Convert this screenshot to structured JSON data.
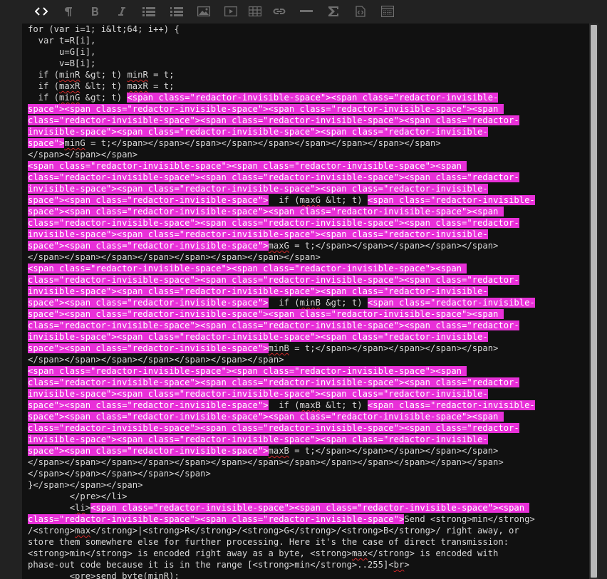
{
  "toolbar": {
    "buttons": [
      {
        "name": "html-toggle",
        "glyph": "<>",
        "active": true
      },
      {
        "name": "paragraph",
        "glyph": "¶"
      },
      {
        "name": "bold",
        "glyph": "B"
      },
      {
        "name": "italic",
        "glyph": "I"
      },
      {
        "name": "unordered-list",
        "glyph": ""
      },
      {
        "name": "ordered-list",
        "glyph": ""
      },
      {
        "name": "image",
        "glyph": ""
      },
      {
        "name": "video",
        "glyph": ""
      },
      {
        "name": "table",
        "glyph": ""
      },
      {
        "name": "link",
        "glyph": ""
      },
      {
        "name": "horizontal-rule",
        "glyph": ""
      },
      {
        "name": "formula",
        "glyph": "Σ"
      },
      {
        "name": "code",
        "glyph": ""
      },
      {
        "name": "snippet",
        "glyph": ""
      }
    ]
  },
  "editor": {
    "lines": [
      [
        {
          "t": "for (var i=1; i&lt;64; i++) {"
        }
      ],
      [
        {
          "t": "  var t=R[i],"
        }
      ],
      [
        {
          "t": "      u=G[i],"
        }
      ],
      [
        {
          "t": "      v=B[i];"
        }
      ],
      [
        {
          "t": "  if ("
        },
        {
          "t": "minR",
          "sq": true
        },
        {
          "t": " &gt; t) "
        },
        {
          "t": "minR",
          "sq": true
        },
        {
          "t": " = t;"
        }
      ],
      [
        {
          "t": "  if ("
        },
        {
          "t": "maxR",
          "sq": true
        },
        {
          "t": " &lt; t) "
        },
        {
          "t": "maxR",
          "sq": true
        },
        {
          "t": " = t;"
        }
      ],
      [
        {
          "t": "  if ("
        },
        {
          "t": "minG",
          "sq": true
        },
        {
          "t": " &gt; t) "
        },
        {
          "t": "<span class=\"redactor-invisible-space\"><span class=\"redactor-invisible-",
          "hl": true
        }
      ],
      [
        {
          "t": "space\"><span class=\"redactor-invisible-space\"><span class=\"redactor-invisible-space\"><span ",
          "hl": true
        }
      ],
      [
        {
          "t": "class=\"redactor-invisible-space\"><span class=\"redactor-invisible-space\"><span class=\"redactor-",
          "hl": true
        }
      ],
      [
        {
          "t": "invisible-space\"><span class=\"redactor-invisible-space\"><span class=\"redactor-invisible-",
          "hl": true
        }
      ],
      [
        {
          "t": "space\">",
          "hl": true
        },
        {
          "t": "minG",
          "sq": true
        },
        {
          "t": " = t;</span></span></span></span></span></span></span></span></span>"
        }
      ],
      [
        {
          "t": "</span></span></span>"
        }
      ],
      [
        {
          "t": "<span class=\"redactor-invisible-space\"><span class=\"redactor-invisible-space\"><span ",
          "hl": true
        }
      ],
      [
        {
          "t": "class=\"redactor-invisible-space\"><span class=\"redactor-invisible-space\"><span class=\"redactor-",
          "hl": true
        }
      ],
      [
        {
          "t": "invisible-space\"><span class=\"redactor-invisible-space\"><span class=\"redactor-invisible-",
          "hl": true
        }
      ],
      [
        {
          "t": "space\"><span class=\"redactor-invisible-space\">",
          "hl": true
        },
        {
          "t": "  if ("
        },
        {
          "t": "maxG",
          "sq": true
        },
        {
          "t": " &lt; t) "
        },
        {
          "t": "<span class=\"redactor-invisible-",
          "hl": true
        }
      ],
      [
        {
          "t": "space\"><span class=\"redactor-invisible-space\"><span class=\"redactor-invisible-space\"><span ",
          "hl": true
        }
      ],
      [
        {
          "t": "class=\"redactor-invisible-space\"><span class=\"redactor-invisible-space\"><span class=\"redactor-",
          "hl": true
        }
      ],
      [
        {
          "t": "invisible-space\"><span class=\"redactor-invisible-space\"><span class=\"redactor-invisible-",
          "hl": true
        }
      ],
      [
        {
          "t": "space\"><span class=\"redactor-invisible-space\">",
          "hl": true
        },
        {
          "t": "maxG",
          "sq": true
        },
        {
          "t": " = t;</span></span></span></span></span>"
        }
      ],
      [
        {
          "t": "</span></span></span></span></span></span></span></span>"
        }
      ],
      [
        {
          "t": "<span class=\"redactor-invisible-space\"><span class=\"redactor-invisible-space\"><span ",
          "hl": true
        }
      ],
      [
        {
          "t": "class=\"redactor-invisible-space\"><span class=\"redactor-invisible-space\"><span class=\"redactor-",
          "hl": true
        }
      ],
      [
        {
          "t": "invisible-space\"><span class=\"redactor-invisible-space\"><span class=\"redactor-invisible-",
          "hl": true
        }
      ],
      [
        {
          "t": "space\"><span class=\"redactor-invisible-space\">",
          "hl": true
        },
        {
          "t": "  if ("
        },
        {
          "t": "minB",
          "sq": true
        },
        {
          "t": " &gt; t) "
        },
        {
          "t": "<span class=\"redactor-invisible-",
          "hl": true
        }
      ],
      [
        {
          "t": "space\"><span class=\"redactor-invisible-space\"><span class=\"redactor-invisible-space\"><span ",
          "hl": true
        }
      ],
      [
        {
          "t": "class=\"redactor-invisible-space\"><span class=\"redactor-invisible-space\"><span class=\"redactor-",
          "hl": true
        }
      ],
      [
        {
          "t": "invisible-space\"><span class=\"redactor-invisible-space\"><span class=\"redactor-invisible-",
          "hl": true
        }
      ],
      [
        {
          "t": "space\"><span class=\"redactor-invisible-space\">",
          "hl": true
        },
        {
          "t": "minB",
          "sq": true
        },
        {
          "t": " = t;</span></span></span></span></span>"
        }
      ],
      [
        {
          "t": "</span></span></span></span></span></span></span>"
        }
      ],
      [
        {
          "t": "<span class=\"redactor-invisible-space\"><span class=\"redactor-invisible-space\"><span ",
          "hl": true
        }
      ],
      [
        {
          "t": "class=\"redactor-invisible-space\"><span class=\"redactor-invisible-space\"><span class=\"redactor-",
          "hl": true
        }
      ],
      [
        {
          "t": "invisible-space\"><span class=\"redactor-invisible-space\"><span class=\"redactor-invisible-",
          "hl": true
        }
      ],
      [
        {
          "t": "space\"><span class=\"redactor-invisible-space\">",
          "hl": true
        },
        {
          "t": "  if ("
        },
        {
          "t": "maxB",
          "sq": true
        },
        {
          "t": " &lt; t) "
        },
        {
          "t": "<span class=\"redactor-invisible-",
          "hl": true
        }
      ],
      [
        {
          "t": "space\"><span class=\"redactor-invisible-space\"><span class=\"redactor-invisible-space\"><span ",
          "hl": true
        }
      ],
      [
        {
          "t": "class=\"redactor-invisible-space\"><span class=\"redactor-invisible-space\"><span class=\"redactor-",
          "hl": true
        }
      ],
      [
        {
          "t": "invisible-space\"><span class=\"redactor-invisible-space\"><span class=\"redactor-invisible-",
          "hl": true
        }
      ],
      [
        {
          "t": "space\"><span class=\"redactor-invisible-space\">",
          "hl": true
        },
        {
          "t": "maxB",
          "sq": true
        },
        {
          "t": " = t;</span></span></span></span></span>"
        }
      ],
      [
        {
          "t": "</span></span></span></span></span></span></span></span></span></span></span></span></span>"
        }
      ],
      [
        {
          "t": "</span></span></span></span></span>"
        }
      ],
      [
        {
          "t": "}</span></span></span>"
        }
      ],
      [
        {
          "t": "        </pre></li>"
        }
      ],
      [
        {
          "t": "        <"
        },
        {
          "t": "li",
          "sq": true
        },
        {
          "t": ">"
        },
        {
          "t": "<span class=\"redactor-invisible-space\"><span class=\"redactor-invisible-space\"><span ",
          "hl": true
        }
      ],
      [
        {
          "t": "class=\"redactor-invisible-space\"><span class=\"redactor-invisible-space\">",
          "hl": true
        },
        {
          "t": "Send <strong>min</strong>"
        }
      ],
      [
        {
          "t": "/<strong>"
        },
        {
          "t": "max",
          "sq": true
        },
        {
          "t": "</strong>|<strong>R</strong>/<strong>G</strong>/<strong>B</strong>/ right away, or"
        }
      ],
      [
        {
          "t": "store them somewhere else for further processing. Here it's the case of direct transmission:"
        }
      ],
      [
        {
          "t": "<strong>min</strong> is encoded right away as a byte, <strong>"
        },
        {
          "t": "max",
          "sq": true
        },
        {
          "t": "</strong> is encoded with"
        }
      ],
      [
        {
          "t": "phase-out code because it is in the range [<strong>min</strong>..255]<"
        },
        {
          "t": "br",
          "sq": true
        },
        {
          "t": ">"
        }
      ],
      [
        {
          "t": "        <pre>send byte(minR);"
        }
      ]
    ]
  },
  "colors": {
    "highlight": "#e830d8",
    "editor_bg": "#111111",
    "toolbar_bg": "#222222",
    "text": "#d8d8d8"
  }
}
